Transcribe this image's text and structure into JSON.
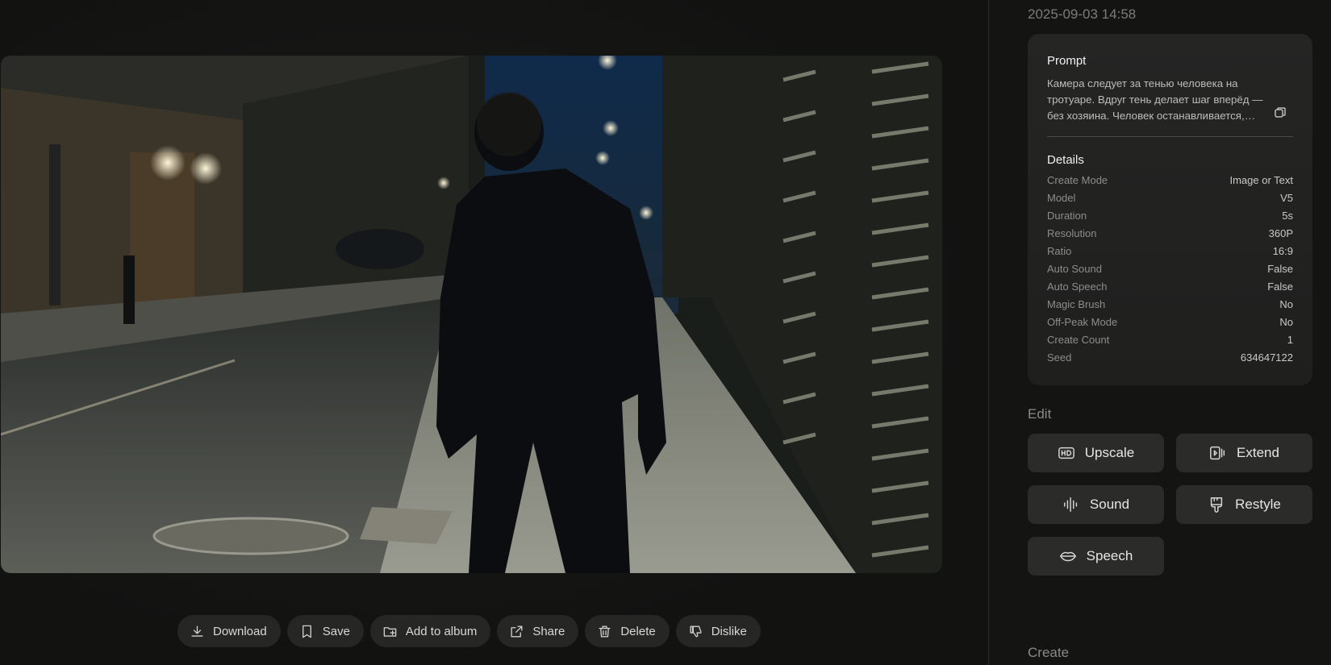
{
  "timestamp": "2025-09-03 14:58",
  "prompt": {
    "heading": "Prompt",
    "text": "Камера следует за тенью человека на тротуаре. Вдруг тень делает шаг вперёд — без хозяина. Человек останавливается, оборачивается..."
  },
  "details": {
    "heading": "Details",
    "rows": [
      {
        "key": "Create Mode",
        "value": "Image or Text"
      },
      {
        "key": "Model",
        "value": "V5"
      },
      {
        "key": "Duration",
        "value": "5s"
      },
      {
        "key": "Resolution",
        "value": "360P"
      },
      {
        "key": "Ratio",
        "value": "16:9"
      },
      {
        "key": "Auto Sound",
        "value": "False"
      },
      {
        "key": "Auto Speech",
        "value": "False"
      },
      {
        "key": "Magic Brush",
        "value": "No"
      },
      {
        "key": "Off-Peak Mode",
        "value": "No"
      },
      {
        "key": "Create Count",
        "value": "1"
      },
      {
        "key": "Seed",
        "value": "634647122"
      }
    ]
  },
  "edit": {
    "heading": "Edit",
    "tools": [
      {
        "label": "Upscale",
        "icon": "hd-icon"
      },
      {
        "label": "Extend",
        "icon": "extend-icon"
      },
      {
        "label": "Sound",
        "icon": "sound-wave-icon"
      },
      {
        "label": "Restyle",
        "icon": "paint-brush-icon"
      },
      {
        "label": "Speech",
        "icon": "lips-icon"
      }
    ]
  },
  "create": {
    "heading": "Create"
  },
  "actions": [
    {
      "label": "Download",
      "icon": "download-icon"
    },
    {
      "label": "Save",
      "icon": "bookmark-icon"
    },
    {
      "label": "Add to album",
      "icon": "album-add-icon"
    },
    {
      "label": "Share",
      "icon": "share-icon"
    },
    {
      "label": "Delete",
      "icon": "trash-icon"
    },
    {
      "label": "Dislike",
      "icon": "thumbs-down-icon"
    }
  ]
}
